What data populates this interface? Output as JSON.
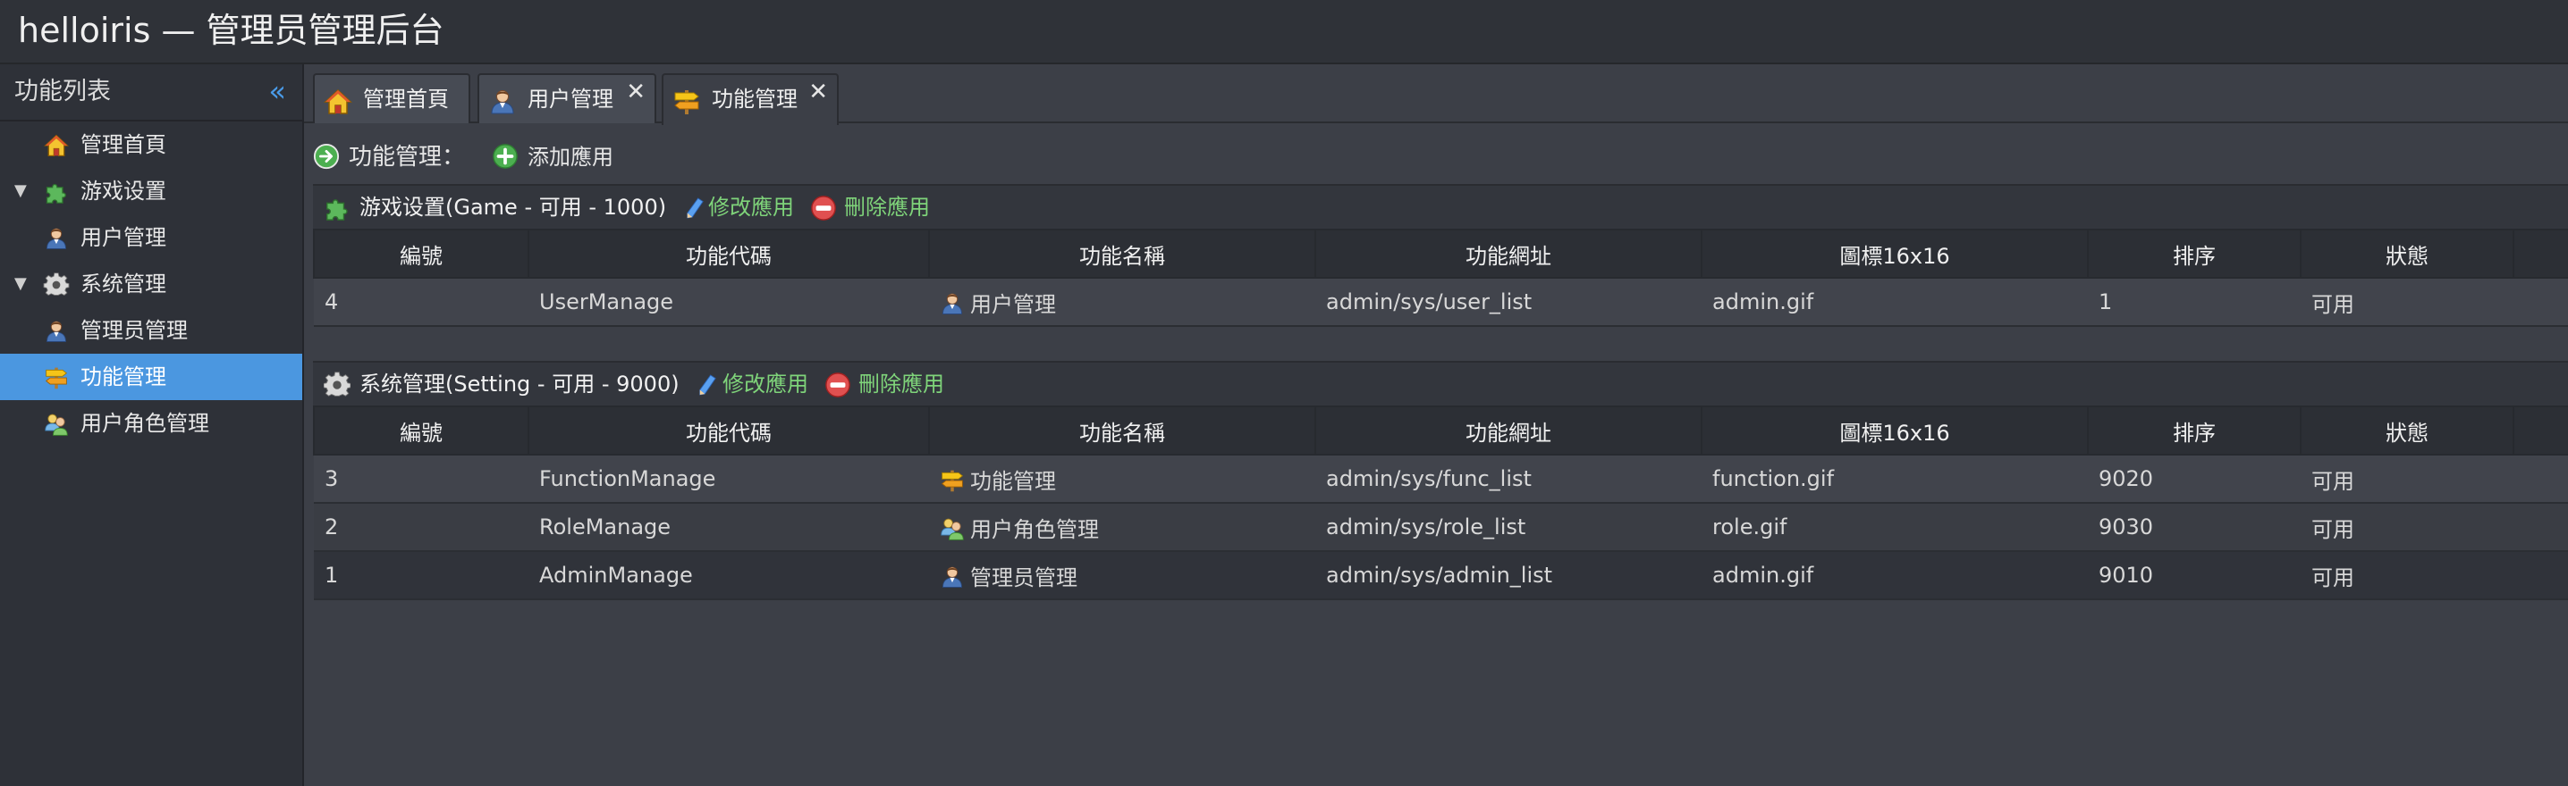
{
  "app": {
    "title": "helloiris — 管理员管理后台"
  },
  "sidebar": {
    "header": "功能列表",
    "collapse_icon": "«",
    "items": [
      {
        "label": "管理首頁",
        "icon": "home-icon"
      },
      {
        "label": "游戏设置",
        "icon": "puzzle-icon",
        "expanded": true
      },
      {
        "label": "用户管理",
        "icon": "user-icon"
      },
      {
        "label": "系统管理",
        "icon": "gear-icon",
        "expanded": true
      },
      {
        "label": "管理员管理",
        "icon": "user-icon"
      },
      {
        "label": "功能管理",
        "icon": "signpost-icon",
        "selected": true
      },
      {
        "label": "用户角色管理",
        "icon": "users-icon"
      }
    ]
  },
  "tabs": [
    {
      "label": "管理首頁",
      "icon": "home-icon"
    },
    {
      "label": "用户管理",
      "icon": "user-icon",
      "close": "✕"
    },
    {
      "label": "功能管理",
      "icon": "signpost-icon",
      "close": "✕",
      "active": true
    }
  ],
  "toolbar": {
    "title": "功能管理：",
    "add_label": "添加應用"
  },
  "columns": [
    "編號",
    "功能代碼",
    "功能名稱",
    "功能網址",
    "圖標16x16",
    "排序",
    "狀態"
  ],
  "groups": [
    {
      "title": "游戏设置(Game - 可用 - 1000)",
      "icon": "puzzle-icon",
      "edit_label": "修改應用",
      "delete_label": "刪除應用",
      "rows": [
        {
          "id": "4",
          "code": "UserManage",
          "name": "用户管理",
          "name_icon": "user-icon",
          "url": "admin/sys/user_list",
          "icon_file": "admin.gif",
          "order": "1",
          "status": "可用"
        }
      ]
    },
    {
      "title": "系统管理(Setting - 可用 - 9000)",
      "icon": "gear-icon",
      "edit_label": "修改應用",
      "delete_label": "刪除應用",
      "rows": [
        {
          "id": "3",
          "code": "FunctionManage",
          "name": "功能管理",
          "name_icon": "signpost-icon",
          "url": "admin/sys/func_list",
          "icon_file": "function.gif",
          "order": "9020",
          "status": "可用"
        },
        {
          "id": "2",
          "code": "RoleManage",
          "name": "用户角色管理",
          "name_icon": "users-icon",
          "url": "admin/sys/role_list",
          "icon_file": "role.gif",
          "order": "9030",
          "status": "可用"
        },
        {
          "id": "1",
          "code": "AdminManage",
          "name": "管理员管理",
          "name_icon": "user-icon",
          "url": "admin/sys/admin_list",
          "icon_file": "admin.gif",
          "order": "9010",
          "status": "可用"
        }
      ]
    }
  ],
  "colors": {
    "accent": "#4b97e0",
    "link": "#7fd47a",
    "background": "#3c3f47"
  }
}
